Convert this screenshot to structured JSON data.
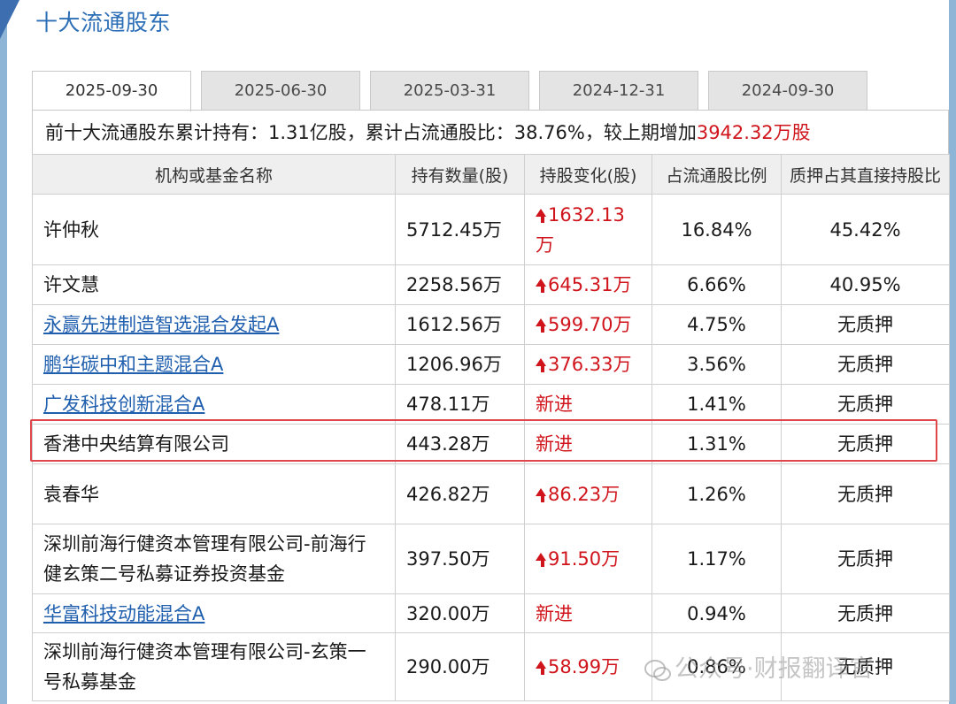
{
  "section_title": "十大流通股东",
  "tabs": [
    {
      "label": "2025-09-30",
      "active": true
    },
    {
      "label": "2025-06-30",
      "active": false
    },
    {
      "label": "2025-03-31",
      "active": false
    },
    {
      "label": "2024-12-31",
      "active": false
    },
    {
      "label": "2024-09-30",
      "active": false
    }
  ],
  "summary": {
    "prefix": "前十大流通股东累计持有：1.31亿股，累计占流通股比：38.76%，较上期增加",
    "increase": "3942.32万股"
  },
  "table": {
    "headers": [
      "机构或基金名称",
      "持有数量(股)",
      "持股变化(股)",
      "占流通股比例",
      "质押占其直接持股比"
    ],
    "rows": [
      {
        "name": "许仲秋",
        "link": false,
        "shares": "5712.45万",
        "change": "1632.13万",
        "change_type": "up",
        "ratio": "16.84%",
        "pledge": "45.42%"
      },
      {
        "name": "许文慧",
        "link": false,
        "shares": "2258.56万",
        "change": "645.31万",
        "change_type": "up",
        "ratio": "6.66%",
        "pledge": "40.95%"
      },
      {
        "name": "永赢先进制造智选混合发起A",
        "link": true,
        "shares": "1612.56万",
        "change": "599.70万",
        "change_type": "up",
        "ratio": "4.75%",
        "pledge": "无质押"
      },
      {
        "name": "鹏华碳中和主题混合A",
        "link": true,
        "shares": "1206.96万",
        "change": "376.33万",
        "change_type": "up",
        "ratio": "3.56%",
        "pledge": "无质押"
      },
      {
        "name": "广发科技创新混合A",
        "link": true,
        "shares": "478.11万",
        "change": "新进",
        "change_type": "new",
        "ratio": "1.41%",
        "pledge": "无质押"
      },
      {
        "name": "香港中央结算有限公司",
        "link": false,
        "shares": "443.28万",
        "change": "新进",
        "change_type": "new",
        "ratio": "1.31%",
        "pledge": "无质押"
      },
      {
        "name": "袁春华",
        "link": false,
        "shares": "426.82万",
        "change": "86.23万",
        "change_type": "up",
        "ratio": "1.26%",
        "pledge": "无质押"
      },
      {
        "name": "深圳前海行健资本管理有限公司-前海行健玄策二号私募证券投资基金",
        "link": false,
        "shares": "397.50万",
        "change": "91.50万",
        "change_type": "up",
        "ratio": "1.17%",
        "pledge": "无质押"
      },
      {
        "name": "华富科技动能混合A",
        "link": true,
        "shares": "320.00万",
        "change": "新进",
        "change_type": "new",
        "ratio": "0.94%",
        "pledge": "无质押"
      },
      {
        "name": "深圳前海行健资本管理有限公司-玄策一号私募基金",
        "link": false,
        "shares": "290.00万",
        "change": "58.99万",
        "change_type": "up",
        "ratio": "0.86%",
        "pledge": "无质押"
      }
    ]
  },
  "watermark": "公众号·财报翻译官",
  "colors": {
    "accent": "#2d6fb7",
    "up_red": "#d0141b",
    "highlight": "#e0474c"
  }
}
